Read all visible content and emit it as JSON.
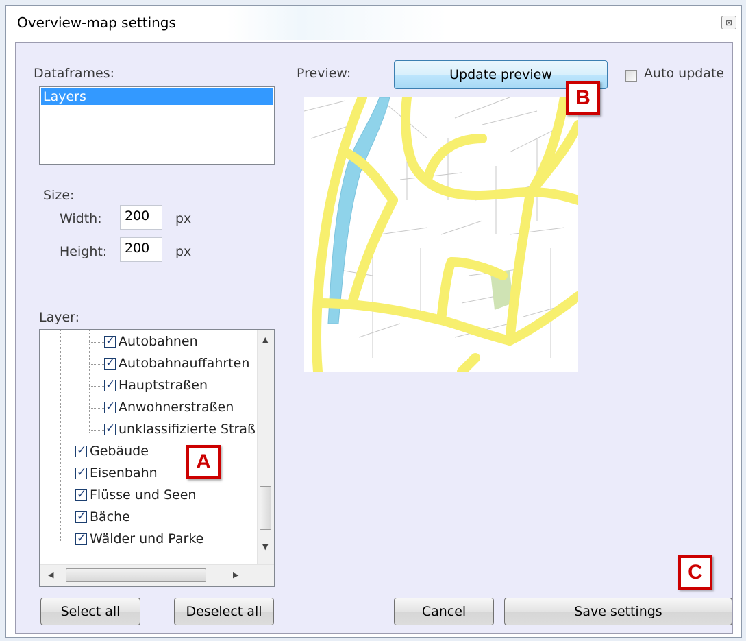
{
  "window": {
    "title": "Overview-map settings",
    "close_glyph": "⊠"
  },
  "dataframes": {
    "label": "Dataframes:",
    "items": [
      "Layers"
    ]
  },
  "size": {
    "label": "Size:",
    "width_label": "Width:",
    "width_value": "200",
    "width_unit": "px",
    "height_label": "Height:",
    "height_value": "200",
    "height_unit": "px"
  },
  "layer": {
    "label": "Layer:",
    "items": [
      {
        "label": "Autobahnen",
        "checked": true
      },
      {
        "label": "Autobahnauffahrten",
        "checked": true
      },
      {
        "label": "Hauptstraßen",
        "checked": true
      },
      {
        "label": "Anwohnerstraßen",
        "checked": true
      },
      {
        "label": "unklassifizierte Straß",
        "checked": true
      },
      {
        "label": "Gebäude",
        "checked": true
      },
      {
        "label": "Eisenbahn",
        "checked": true
      },
      {
        "label": "Flüsse und Seen",
        "checked": true
      },
      {
        "label": "Bäche",
        "checked": true
      },
      {
        "label": "Wälder und Parke",
        "checked": true
      }
    ]
  },
  "preview": {
    "label": "Preview:",
    "update_button": "Update preview",
    "auto_update_label": "Auto update",
    "auto_update_checked": false
  },
  "buttons": {
    "select_all": "Select all",
    "deselect_all": "Deselect all",
    "cancel": "Cancel",
    "save_settings": "Save settings"
  },
  "markers": {
    "a": "A",
    "b": "B",
    "c": "C"
  },
  "colors": {
    "road": "#f7ef6e",
    "water": "#8fd3ea",
    "park": "#cfe3b4",
    "marker": "#cc0000",
    "selection": "#3399ff"
  }
}
